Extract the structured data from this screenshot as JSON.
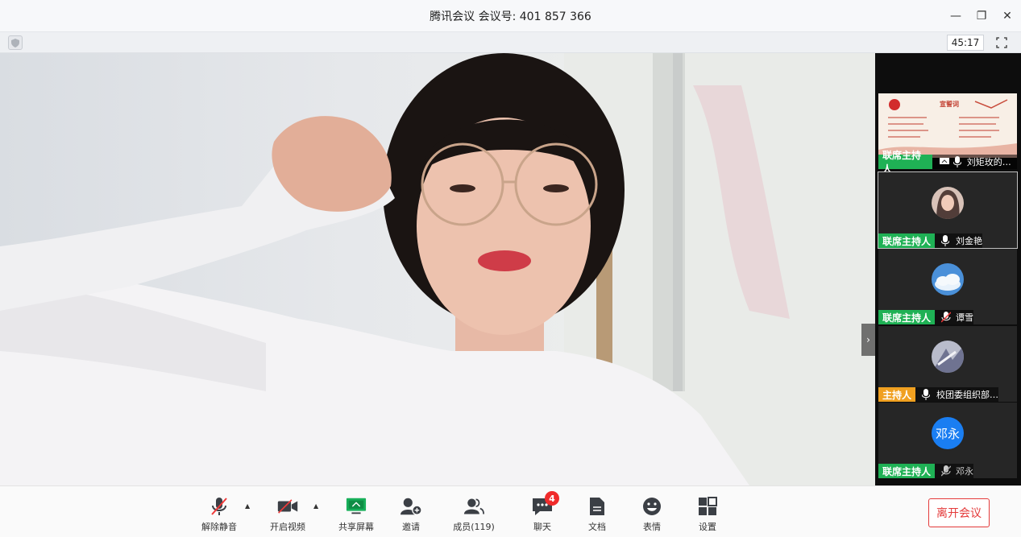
{
  "window": {
    "title": "腾讯会议 会议号: 401 857 366",
    "minimize_icon": "—",
    "restore_icon": "❐",
    "close_icon": "✕"
  },
  "status": {
    "timer": "45:17"
  },
  "main_video": {
    "expand_glyph": "›"
  },
  "participants": [
    {
      "role": "联席主持人",
      "role_color": "#1fb155",
      "name": "刘矩玫的屏…",
      "kind": "screen-share"
    },
    {
      "role": "联席主持人",
      "role_color": "#1fb155",
      "name": "刘金艳",
      "kind": "photo"
    },
    {
      "role": "联席主持人",
      "role_color": "#1fb155",
      "name": "谭雪",
      "kind": "sky",
      "muted": true
    },
    {
      "role": "主持人",
      "role_color": "#f0a020",
      "name": "校团委组织部…",
      "kind": "art"
    },
    {
      "role": "联席主持人",
      "role_color": "#1fb155",
      "name": "邓永",
      "kind": "initials",
      "initials": "邓永",
      "muted": true
    }
  ],
  "screen_share": {
    "heading": "宣誓词"
  },
  "toolbar": {
    "unmute": "解除静音",
    "start_video": "开启视频",
    "share_screen": "共享屏幕",
    "invite": "邀请",
    "members": "成员(119)",
    "chat": "聊天",
    "chat_badge": "4",
    "docs": "文档",
    "reactions": "表情",
    "settings": "设置",
    "leave": "离开会议"
  }
}
